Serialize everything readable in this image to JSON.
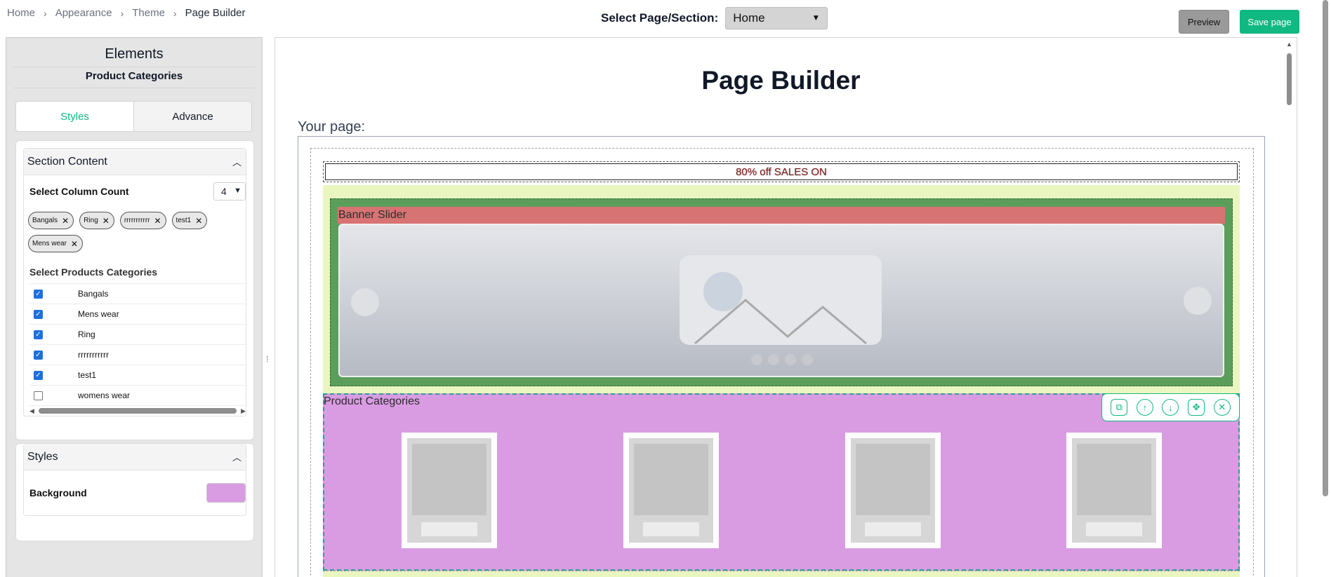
{
  "breadcrumb": {
    "items": [
      "Home",
      "Appearance",
      "Theme",
      "Page Builder"
    ],
    "separator": "›"
  },
  "header": {
    "select_label": "Select Page/Section:",
    "select_value": "Home",
    "preview_label": "Preview",
    "save_label": "Save page"
  },
  "sidebar": {
    "title": "Elements",
    "subtitle": "Product Categories",
    "tabs": [
      {
        "label": "Styles",
        "active": true
      },
      {
        "label": "Advance",
        "active": false
      }
    ],
    "section_content": {
      "heading": "Section Content",
      "column_count_label": "Select Column Count",
      "column_count_value": "4",
      "chips": [
        "Bangals",
        "Ring",
        "rrrrrrrrrrr",
        "test1",
        "Mens wear"
      ],
      "categories_label": "Select Products Categories",
      "categories": [
        {
          "label": "Bangals",
          "checked": true
        },
        {
          "label": "Mens wear",
          "checked": true
        },
        {
          "label": "Ring",
          "checked": true
        },
        {
          "label": "rrrrrrrrrrr",
          "checked": true
        },
        {
          "label": "test1",
          "checked": true
        },
        {
          "label": "womens wear",
          "checked": false
        }
      ]
    },
    "styles": {
      "heading": "Styles",
      "background_label": "Background",
      "background_color": "#d99ce3"
    }
  },
  "canvas": {
    "title": "Page Builder",
    "your_page_label": "Your page:",
    "sale_text": "80% off SALES ON",
    "banner_label": "Banner Slider",
    "product_categories_label": "Product Categories",
    "product_card_count": 4
  },
  "colors": {
    "accent": "#10b981",
    "lime": "#eaf6c0",
    "green": "#5b9e5b",
    "banner_red": "#d87373",
    "pink": "#d99ce3"
  }
}
